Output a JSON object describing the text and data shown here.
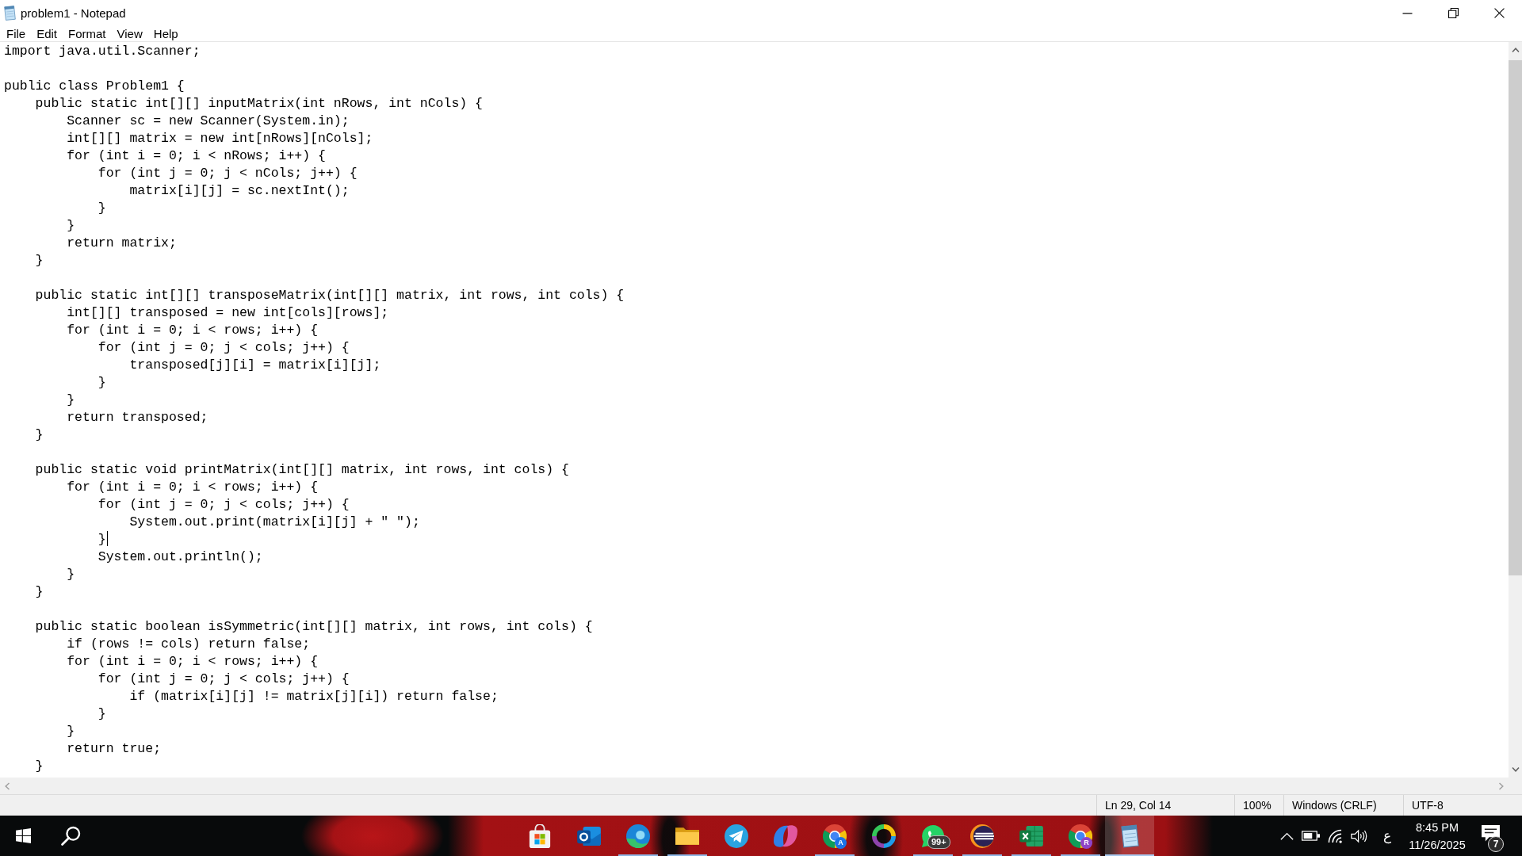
{
  "window": {
    "title": "problem1 - Notepad"
  },
  "menu": [
    "File",
    "Edit",
    "Format",
    "View",
    "Help"
  ],
  "editor": {
    "blocks": [
      {
        "lines": [
          {
            "text": "import java.util.Scanner;",
            "caret": false
          }
        ]
      },
      {
        "lines": [
          {
            "text": "public class Problem1 {",
            "caret": false
          },
          {
            "text": "    public static int[][] inputMatrix(int nRows, int nCols) {",
            "caret": false
          },
          {
            "text": "        Scanner sc = new Scanner(System.in);",
            "caret": false
          },
          {
            "text": "        int[][] matrix = new int[nRows][nCols];",
            "caret": false
          },
          {
            "text": "        for (int i = 0; i < nRows; i++) {",
            "caret": false
          },
          {
            "text": "            for (int j = 0; j < nCols; j++) {",
            "caret": false
          },
          {
            "text": "                matrix[i][j] = sc.nextInt();",
            "caret": false
          },
          {
            "text": "            }",
            "caret": false
          },
          {
            "text": "        }",
            "caret": false
          },
          {
            "text": "        return matrix;",
            "caret": false
          },
          {
            "text": "    }",
            "caret": false
          }
        ]
      },
      {
        "lines": [
          {
            "text": "    public static int[][] transposeMatrix(int[][] matrix, int rows, int cols) {",
            "caret": false
          },
          {
            "text": "        int[][] transposed = new int[cols][rows];",
            "caret": false
          },
          {
            "text": "        for (int i = 0; i < rows; i++) {",
            "caret": false
          },
          {
            "text": "            for (int j = 0; j < cols; j++) {",
            "caret": false
          },
          {
            "text": "                transposed[j][i] = matrix[i][j];",
            "caret": false
          },
          {
            "text": "            }",
            "caret": false
          },
          {
            "text": "        }",
            "caret": false
          },
          {
            "text": "        return transposed;",
            "caret": false
          },
          {
            "text": "    }",
            "caret": false
          }
        ]
      },
      {
        "lines": [
          {
            "text": "    public static void printMatrix(int[][] matrix, int rows, int cols) {",
            "caret": false
          },
          {
            "text": "        for (int i = 0; i < rows; i++) {",
            "caret": false
          },
          {
            "text": "            for (int j = 0; j < cols; j++) {",
            "caret": false
          },
          {
            "text": "                System.out.print(matrix[i][j] + \" \");",
            "caret": false
          },
          {
            "text": "            }",
            "caret": true
          },
          {
            "text": "            System.out.println();",
            "caret": false
          },
          {
            "text": "        }",
            "caret": false
          },
          {
            "text": "    }",
            "caret": false
          }
        ]
      },
      {
        "lines": [
          {
            "text": "    public static boolean isSymmetric(int[][] matrix, int rows, int cols) {",
            "caret": false
          },
          {
            "text": "        if (rows != cols) return false;",
            "caret": false
          },
          {
            "text": "        for (int i = 0; i < rows; i++) {",
            "caret": false
          },
          {
            "text": "            for (int j = 0; j < cols; j++) {",
            "caret": false
          },
          {
            "text": "                if (matrix[i][j] != matrix[j][i]) return false;",
            "caret": false
          },
          {
            "text": "            }",
            "caret": false
          },
          {
            "text": "        }",
            "caret": false
          },
          {
            "text": "        return true;",
            "caret": false
          },
          {
            "text": "    }",
            "caret": false
          }
        ]
      }
    ]
  },
  "status_bar": {
    "position": "Ln 29, Col 14",
    "zoom": "100%",
    "line_ending": "Windows (CRLF)",
    "encoding": "UTF-8"
  },
  "taskbar": {
    "apps": [
      {
        "kind": "store",
        "running": false,
        "active": false
      },
      {
        "kind": "mail",
        "running": false,
        "active": false
      },
      {
        "kind": "swirl",
        "running": true,
        "active": false
      },
      {
        "kind": "folder",
        "running": true,
        "active": false
      },
      {
        "kind": "plane",
        "running": false,
        "active": false
      },
      {
        "kind": "ribbon",
        "running": false,
        "active": false
      },
      {
        "kind": "wheel",
        "running": true,
        "active": false,
        "avatar": {
          "letter": "A",
          "color": "#1a73e8"
        }
      },
      {
        "kind": "ring",
        "running": false,
        "active": false
      },
      {
        "kind": "chat",
        "running": true,
        "active": false,
        "badge": "99+"
      },
      {
        "kind": "planet",
        "running": true,
        "active": false
      },
      {
        "kind": "sheet",
        "running": true,
        "active": false
      },
      {
        "kind": "wheel",
        "running": true,
        "active": false,
        "avatar": {
          "letter": "R",
          "color": "#8e44c9"
        }
      },
      {
        "kind": "notepad",
        "running": true,
        "active": true
      }
    ],
    "tray": {
      "language": "ع",
      "time": "8:45 PM",
      "date": "11/26/2025",
      "notifications": "7"
    }
  }
}
